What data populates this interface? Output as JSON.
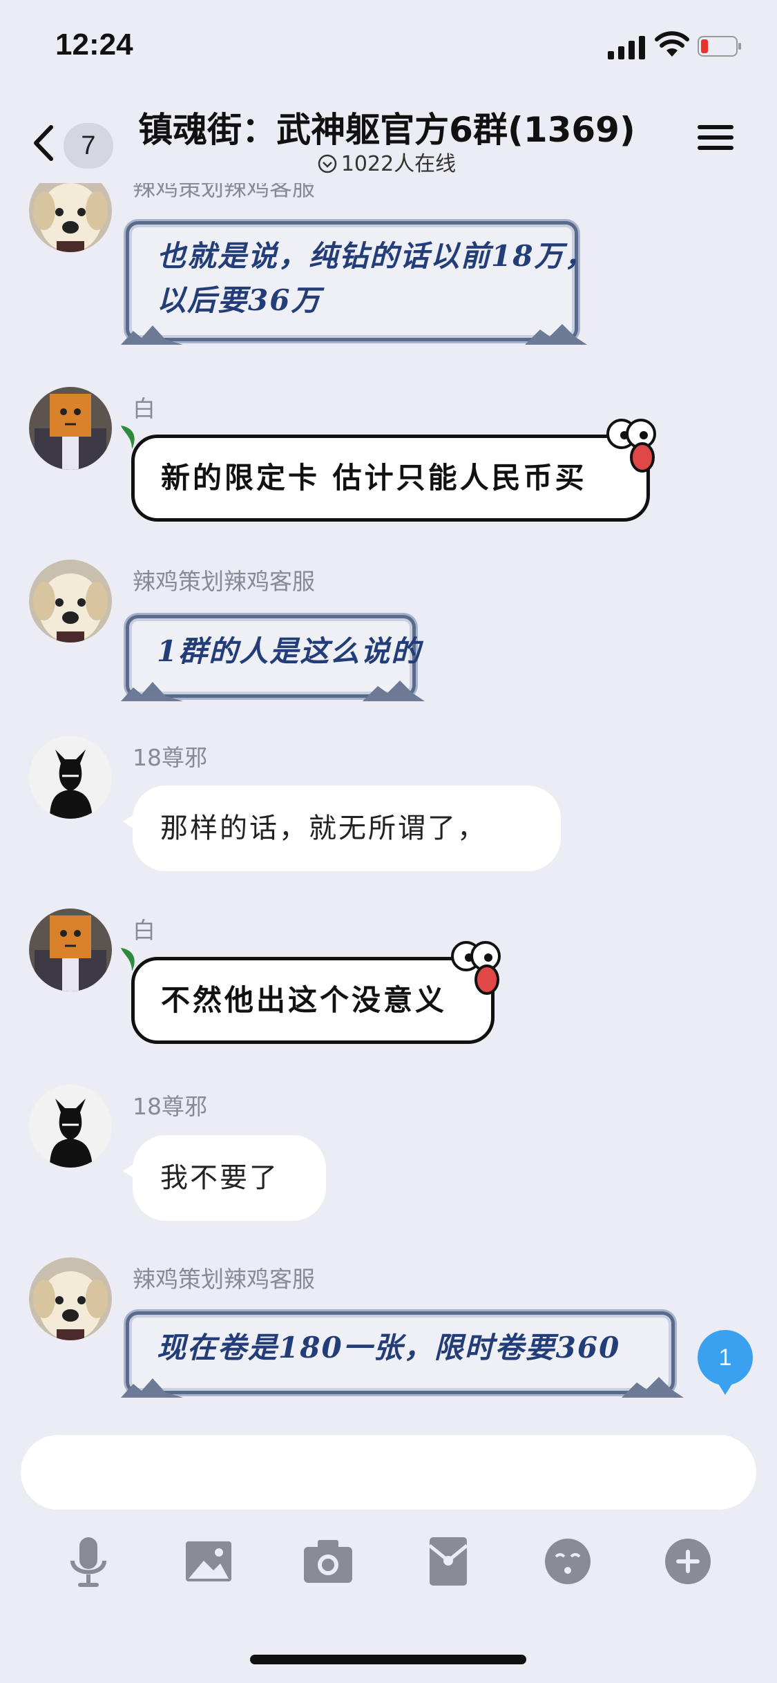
{
  "status_bar": {
    "time": "12:24",
    "battery_state": "low"
  },
  "header": {
    "back_count": "7",
    "title": "镇魂街：武神躯官方6群(1369)",
    "online": "1022人在线"
  },
  "messages": [
    {
      "sender": "辣鸡策划辣鸡客服",
      "style": "scroll",
      "lines": [
        "也就是说，纯钻的话以前18万，",
        "以后要36万"
      ]
    },
    {
      "sender": "白",
      "style": "comic",
      "text": "新的限定卡 估计只能人民币买"
    },
    {
      "sender": "辣鸡策划辣鸡客服",
      "style": "scroll",
      "lines": [
        "1群的人是这么说的"
      ]
    },
    {
      "sender": "18尊邪",
      "style": "plain",
      "text": "那样的话，就无所谓了，"
    },
    {
      "sender": "白",
      "style": "comic",
      "text": "不然他出这个没意义"
    },
    {
      "sender": "18尊邪",
      "style": "plain",
      "text": "我不要了"
    },
    {
      "sender": "辣鸡策划辣鸡客服",
      "style": "scroll",
      "lines": [
        "现在卷是180一张，限时卷要360"
      ]
    }
  ],
  "unread_badge": "1",
  "input": {
    "placeholder": ""
  },
  "toolbar_icons": [
    "microphone-icon",
    "image-icon",
    "camera-icon",
    "red-packet-icon",
    "emoji-icon",
    "plus-icon"
  ],
  "colors": {
    "accent": "#3aa1f1",
    "scroll_text": "#233d78",
    "background": "#ececf5"
  }
}
